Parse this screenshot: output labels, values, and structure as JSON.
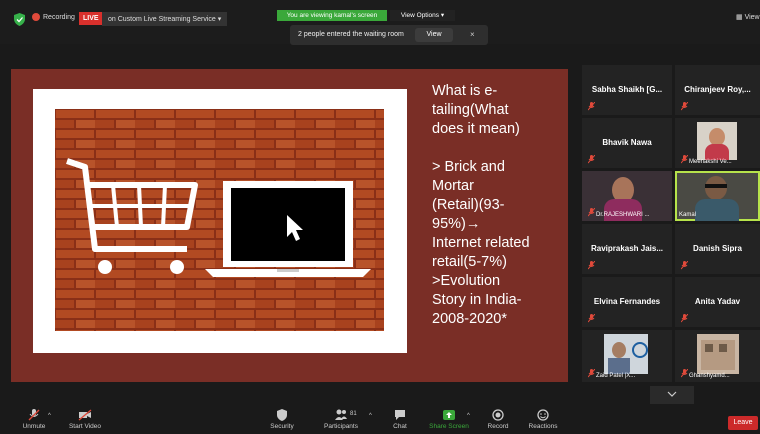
{
  "topbar": {
    "recording_label": "Recording",
    "live_label": "LIVE",
    "stream_label": "on Custom Live Streaming Service",
    "viewing_banner": "You are viewing kamal's screen",
    "view_options": "View Options",
    "waiting_message": "2 people entered the waiting room",
    "waiting_view": "View",
    "waiting_close": "×",
    "view_label": "View"
  },
  "slide": {
    "lines": [
      "What is e-",
      "tailing(What",
      "does it mean)",
      "",
      "> Brick and",
      "Mortar",
      "(Retail)(93-",
      "95%)→",
      "Internet related",
      "retail(5-7%)",
      ">Evolution",
      "Story in India-",
      "2008-2020*"
    ]
  },
  "participants": {
    "p1": "Sabha Shaikh [G...",
    "p2": "Chiranjeev Roy,...",
    "p3": "Bhavik Nawa",
    "p4": "Meenakshi Ve...",
    "p5": "Dr.RAJESHWARI ...",
    "p6": "Kamal",
    "p7": "Raviprakash Jais...",
    "p8": "Danish Sipra",
    "p9": "Elvina Fernandes",
    "p10": "Anita Yadav",
    "p11": "Zaid Patel |X...",
    "p12": "Ghanshyamd..."
  },
  "toolbar": {
    "unmute": "Unmute",
    "start_video": "Start Video",
    "security": "Security",
    "participants": "Participants",
    "participants_count": "81",
    "chat": "Chat",
    "share_screen": "Share Screen",
    "record": "Record",
    "reactions": "Reactions",
    "leave": "Leave"
  },
  "colors": {
    "slide_bg": "#7a2e26",
    "share_green": "#3aa83a",
    "live_red": "#d9302c",
    "active_speaker": "#b7e34b"
  }
}
